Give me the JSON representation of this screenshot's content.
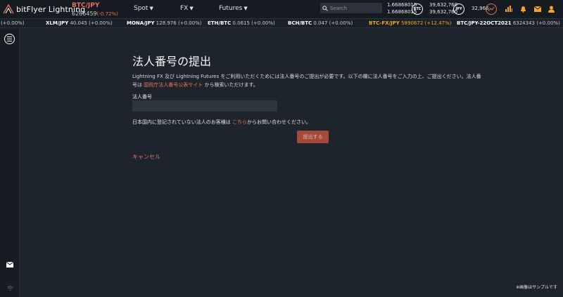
{
  "header": {
    "logo_text": "bitFlyer Lightning",
    "pair_name": "BTC/JPY",
    "pair_price": "6266459",
    "pair_change": "(-0.72%)",
    "menu": [
      "Spot",
      "FX",
      "Futures"
    ],
    "search_placeholder": "Search",
    "btc_balance_1": "1.66868015",
    "btc_balance_2": "1.66868015",
    "btc_coin": "BTC",
    "jpy_balance_1": "39,632,760",
    "jpy_balance_2": "39,632,760",
    "jpy_coin": "JPY",
    "jpy_total": "32,966",
    "icon_colors": {
      "accent": "#f5a623"
    }
  },
  "ticker": [
    {
      "prefix": "",
      "name": "",
      "value": "(+0.00%)",
      "highlight": false
    },
    {
      "prefix": "",
      "name": "XLM/JPY",
      "value": "40.045 (+0.00%)",
      "highlight": false
    },
    {
      "prefix": "",
      "name": "MONA/JPY",
      "value": "128.976 (+0.00%)",
      "highlight": false
    },
    {
      "prefix": "",
      "name": "ETH/BTC",
      "value": "0.0615 (+0.00%)",
      "highlight": false
    },
    {
      "prefix": "",
      "name": "BCH/BTC",
      "value": "0.047 (+0.00%)",
      "highlight": false
    },
    {
      "prefix": "",
      "name": "BTC-FX/JPY",
      "value": "5890672 (+12.47%)",
      "highlight": true
    },
    {
      "prefix": "",
      "name": "BTC/JPY-22OCT2021",
      "value": "6324343 (+0.00%)",
      "highlight": false
    }
  ],
  "form": {
    "title": "法人番号の提出",
    "desc_part1": "Lightning FX 及び Lightning Futures をご利用いただくためには法人番号のご提出が必要です。以下の欄に法人番号をご入力の上、ご提出ください。法人番",
    "desc_part2": "号は",
    "desc_link": "国税庁法人番号公表サイト",
    "desc_part3": "から検索いただけます。",
    "field_label": "法人番号",
    "field_value": "",
    "notice_part1": "日本国内に登記されていない法人のお客様は",
    "notice_link": "こちら",
    "notice_part2": "からお問い合わせください。",
    "submit_label": "提出する",
    "cancel_label": "キャンセル"
  },
  "footer_note": "※画像はサンプルです"
}
